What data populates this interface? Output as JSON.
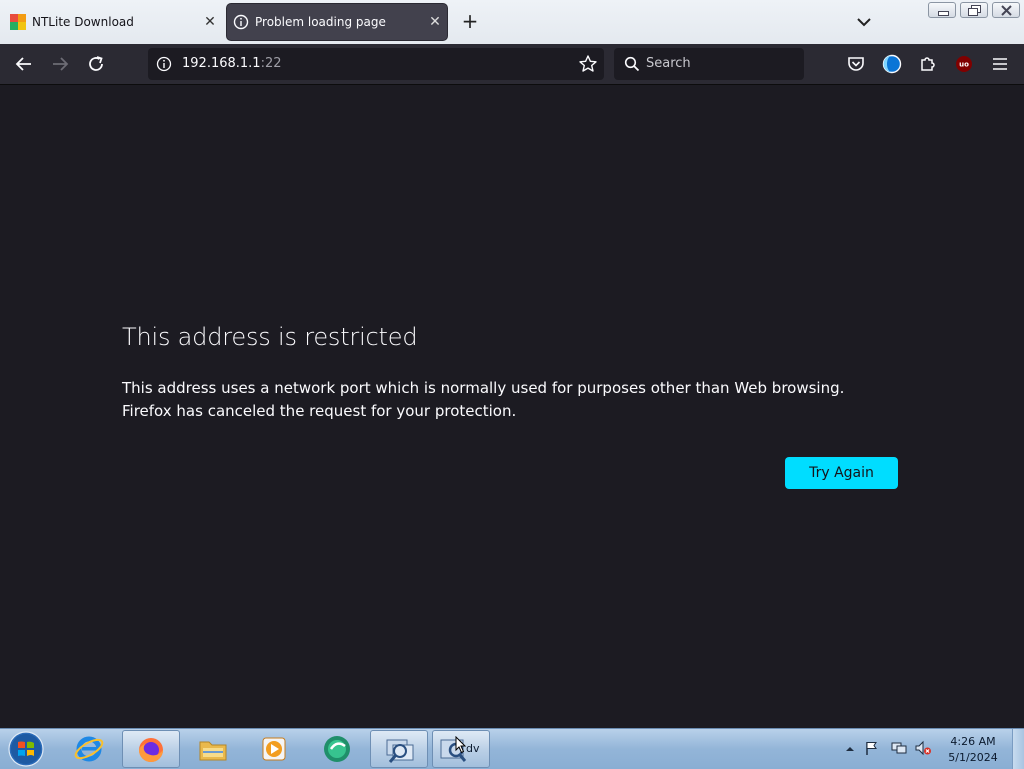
{
  "tabs": [
    {
      "title": "NTLite Download",
      "active": false
    },
    {
      "title": "Problem loading page",
      "active": true
    }
  ],
  "toolbar": {
    "url_host": "192.168.1.1",
    "url_port": ":22",
    "search_placeholder": "Search"
  },
  "error_page": {
    "title": "This address is restricted",
    "description_line1": "This address uses a network port which is normally used for purposes other than Web browsing.",
    "description_line2": "Firefox has canceled the request for your protection.",
    "button_label": "Try Again",
    "accent_color": "#00ddff",
    "background_color": "#1c1b22"
  },
  "taskbar": {
    "items": [
      "start-orb",
      "internet-explorer",
      "firefox",
      "file-explorer",
      "media-player",
      "green-app",
      "network-tool",
      "search-tool"
    ],
    "active_items": [
      "firefox",
      "network-tool",
      "search-tool"
    ],
    "partial_text": "dv",
    "time": "4:26 AM",
    "date": "5/1/2024"
  }
}
